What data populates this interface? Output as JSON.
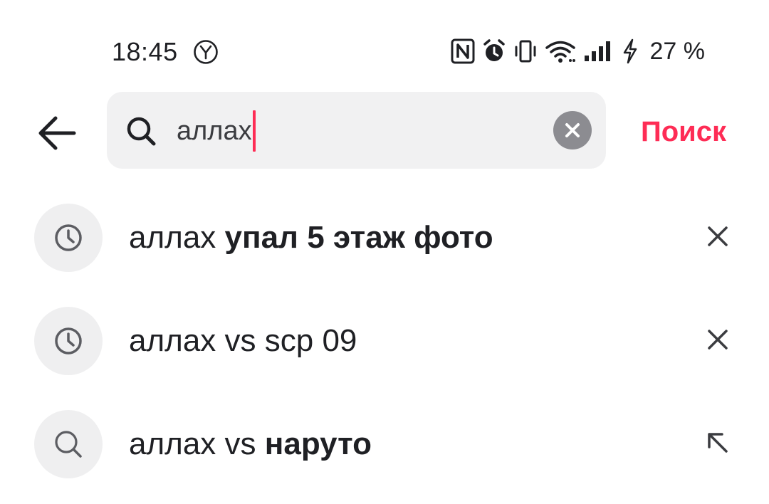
{
  "status_bar": {
    "time": "18:45",
    "app_icon": "yandex-y-icon",
    "icons": [
      "nfc-icon",
      "alarm-icon",
      "vibrate-icon",
      "wifi-icon",
      "signal-icon",
      "charging-bolt-icon"
    ],
    "battery": "27 %"
  },
  "search": {
    "query": "аллах",
    "submit_label": "Поиск",
    "back_icon": "arrow-left-icon",
    "search_icon": "search-icon",
    "clear_icon": "clear-icon"
  },
  "accent_color": "#fe2c55",
  "suggestions": [
    {
      "icon": "history-clock-icon",
      "prefix": "аллах",
      "suffix": "упал 5 этаж фото",
      "action_icon": "remove-x-icon"
    },
    {
      "icon": "history-clock-icon",
      "prefix": "аллах",
      "suffix": "vs scp 09",
      "action_icon": "remove-x-icon"
    },
    {
      "icon": "search-icon",
      "prefix": "аллах",
      "suffix": "наруто",
      "middle": "vs",
      "action_icon": "fill-arrow-icon"
    }
  ]
}
